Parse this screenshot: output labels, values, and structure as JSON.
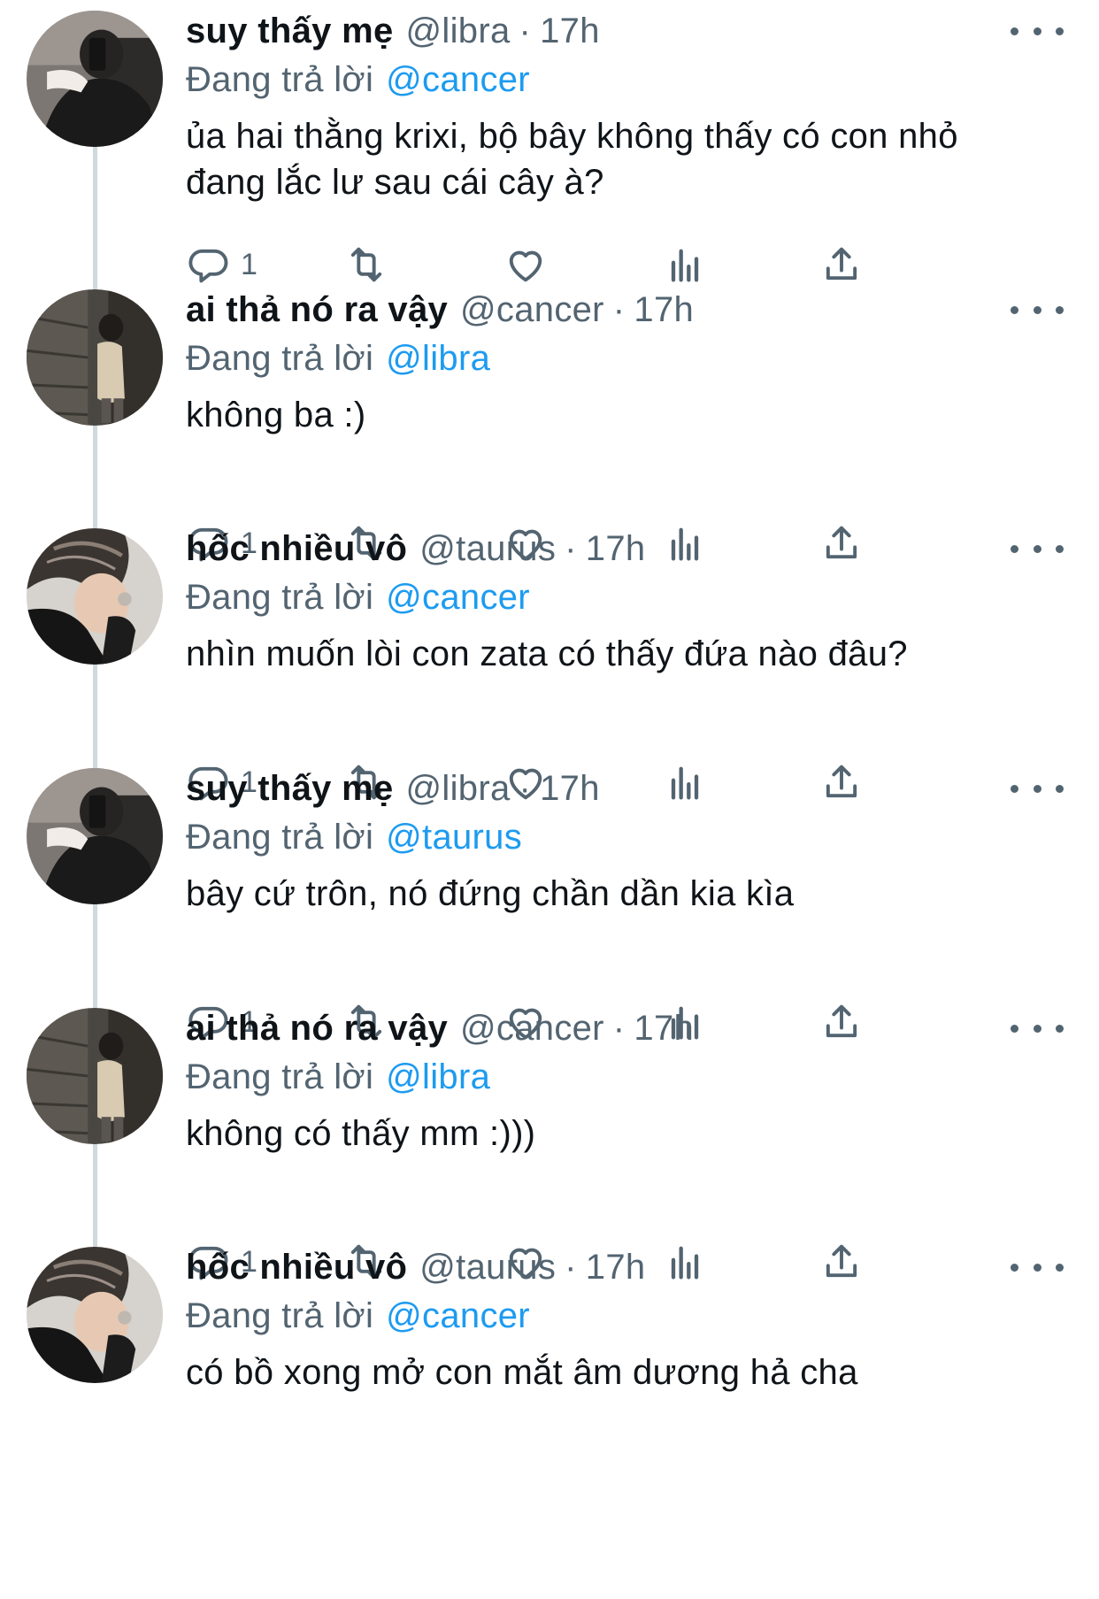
{
  "reply_prefix": "Đang trả lời",
  "colors": {
    "text": "#0f1419",
    "secondary": "#536471",
    "link": "#1d9bf0",
    "thread_line": "#cfd9de"
  },
  "icons": {
    "reply": "reply-icon",
    "retweet": "retweet-icon",
    "like": "heart-icon",
    "views": "views-chart-icon",
    "share": "share-icon",
    "more": "more-options-icon"
  },
  "tweets": [
    {
      "display_name": "suy thấy mẹ",
      "handle": "@libra",
      "time": "17h",
      "reply_to": "@cancer",
      "text_lines": [
        "ủa hai thằng krixi, bộ bây không thấy có con nhỏ",
        "đang lắc lư sau cái cây à?"
      ],
      "reply_count": "1"
    },
    {
      "display_name": "ai thả nó ra vậy",
      "handle": "@cancer",
      "time": "17h",
      "reply_to": "@libra",
      "text_lines": [
        "không ba :)"
      ],
      "reply_count": "1"
    },
    {
      "display_name": "hốc nhiều vô",
      "handle": "@taurus",
      "time": "17h",
      "reply_to": "@cancer",
      "text_lines": [
        "nhìn muốn lòi con zata có thấy đứa nào đâu?"
      ],
      "reply_count": "1"
    },
    {
      "display_name": "suy thấy mẹ",
      "handle": "@libra",
      "time": "17h",
      "reply_to": "@taurus",
      "text_lines": [
        "bây cứ trôn, nó đứng chần dần kia kìa"
      ],
      "reply_count": "1"
    },
    {
      "display_name": "ai thả nó ra vậy",
      "handle": "@cancer",
      "time": "17h",
      "reply_to": "@libra",
      "text_lines": [
        "không có thấy mm :)))"
      ],
      "reply_count": "1"
    },
    {
      "display_name": "hốc nhiều vô",
      "handle": "@taurus",
      "time": "17h",
      "reply_to": "@cancer",
      "text_lines": [
        "có bồ xong mở con mắt âm dương hả cha"
      ],
      "reply_count": ""
    }
  ]
}
